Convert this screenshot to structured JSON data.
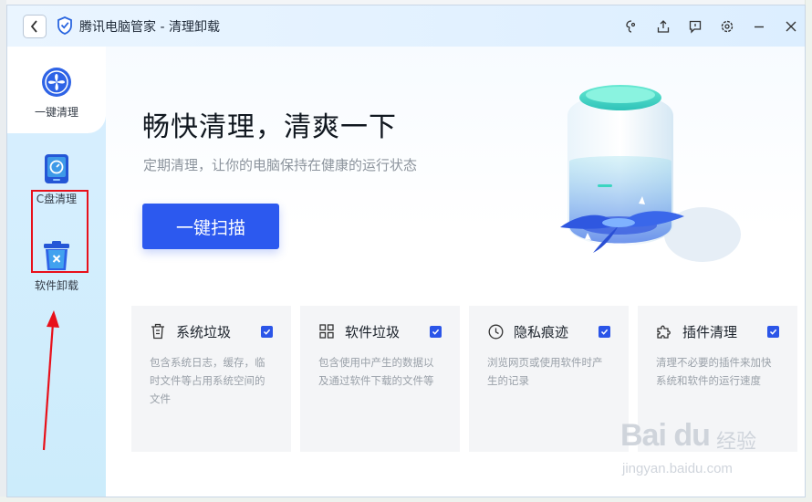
{
  "window": {
    "title": "腾讯电脑管家 - 清理卸载"
  },
  "titlebar_icons": [
    "skin-icon",
    "upload-icon",
    "feedback-icon",
    "settings-icon",
    "minimize-icon",
    "close-icon"
  ],
  "sidebar": {
    "items": [
      {
        "label": "一键清理",
        "icon": "fan-icon",
        "active": true
      },
      {
        "label": "C盘清理",
        "icon": "disk-icon",
        "active": false
      },
      {
        "label": "软件卸载",
        "icon": "trash-icon",
        "active": false
      }
    ]
  },
  "hero": {
    "title": "畅快清理，清爽一下",
    "subtitle": "定期清理，让你的电脑保持在健康的运行状态",
    "scan_label": "一键扫描"
  },
  "cards": [
    {
      "title": "系统垃圾",
      "icon": "trash-outline-icon",
      "checked": true,
      "desc": "包含系统日志，缓存，临时文件等占用系统空间的文件"
    },
    {
      "title": "软件垃圾",
      "icon": "grid-icon",
      "checked": true,
      "desc": "包含使用中产生的数据以及通过软件下载的文件等"
    },
    {
      "title": "隐私痕迹",
      "icon": "clock-icon",
      "checked": true,
      "desc": "浏览网页或使用软件时产生的记录"
    },
    {
      "title": "插件清理",
      "icon": "puzzle-icon",
      "checked": true,
      "desc": "清理不必要的插件来加快系统和软件的运行速度"
    }
  ],
  "watermark": {
    "logo": "Bai du",
    "cn": "经验",
    "url": "jingyan.baidu.com"
  },
  "colors": {
    "accent": "#2c59ef",
    "sidebar_bg": "#d9efff",
    "annotation_red": "#e8101a"
  }
}
